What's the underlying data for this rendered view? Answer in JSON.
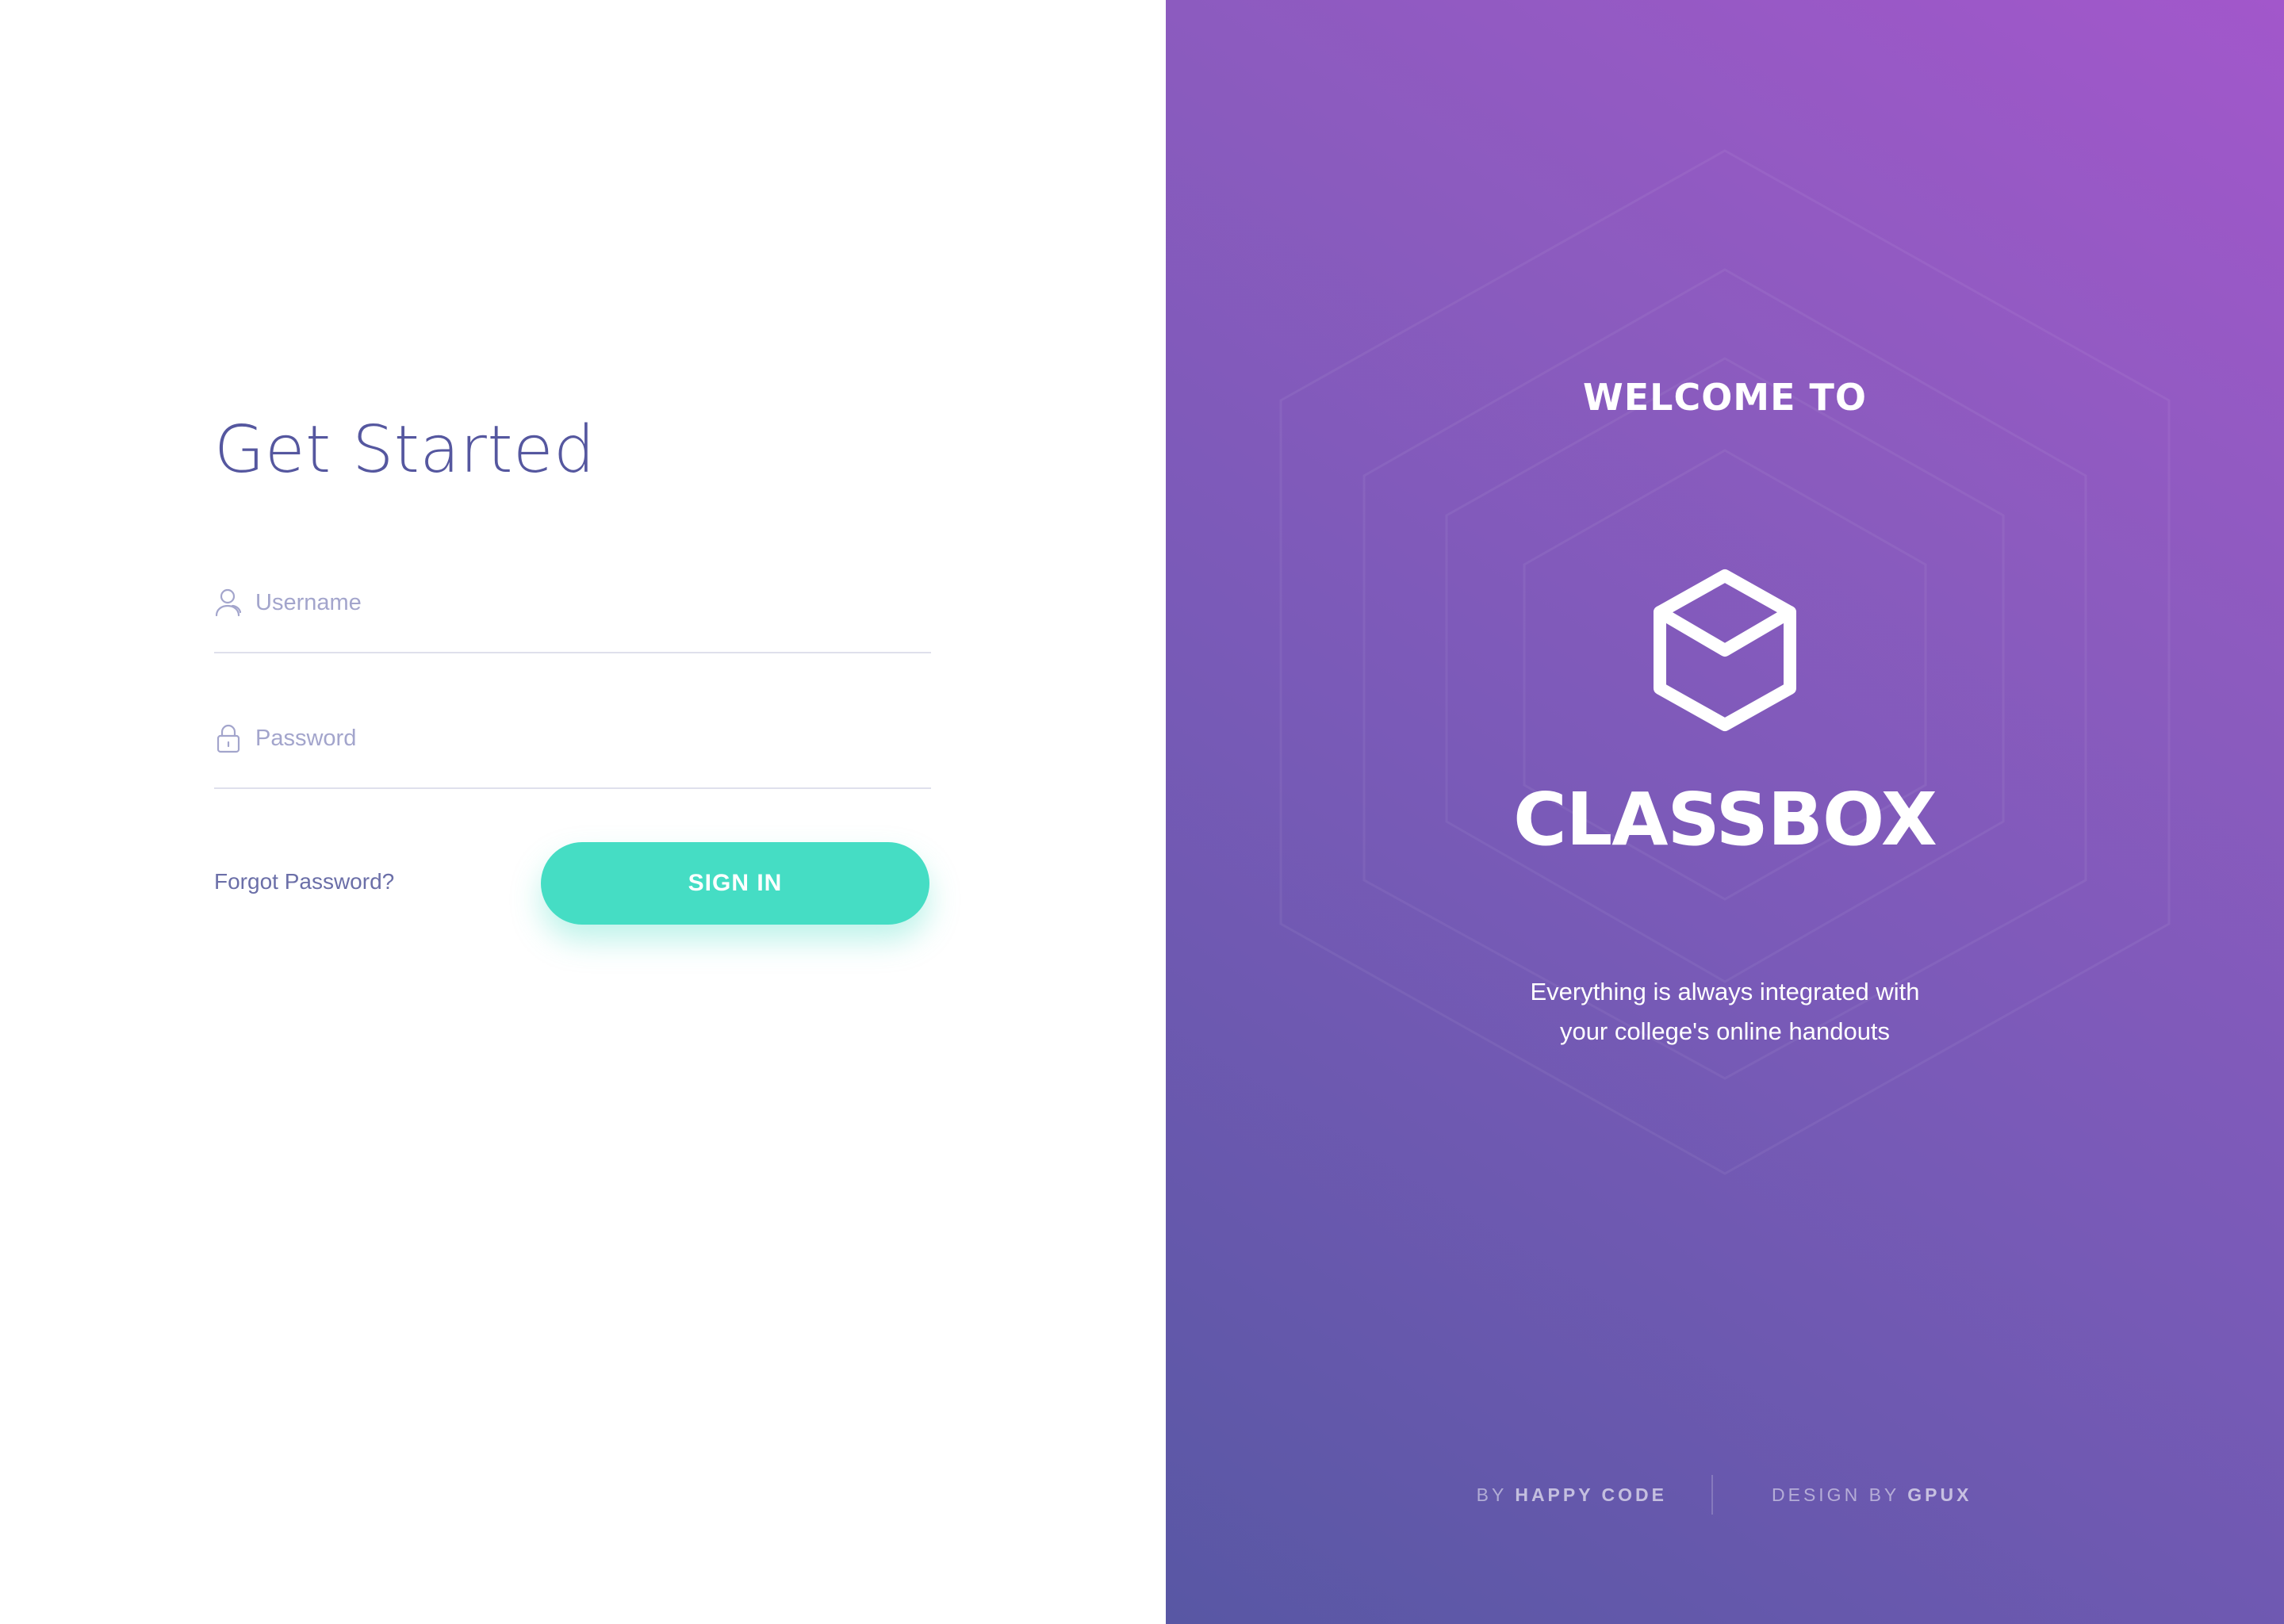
{
  "login": {
    "title": "Get Started",
    "username_placeholder": "Username",
    "password_placeholder": "Password",
    "forgot_password": "Forgot Password?",
    "signin_label": "SIGN IN"
  },
  "brand": {
    "welcome": "WELCOME TO",
    "name": "CLASSBOX",
    "logo_icon": "cube-icon",
    "tagline_line1": "Everything is always integrated with",
    "tagline_line2": "your college's online handouts"
  },
  "footer": {
    "by_prefix": "BY",
    "by_name": "HAPPY CODE",
    "design_prefix": "DESIGN BY",
    "design_name": "GPUX"
  },
  "colors": {
    "accent": "#45ddc4",
    "title": "#55579f",
    "gradient_top": "#a257cb",
    "gradient_bottom": "#5857a4"
  }
}
